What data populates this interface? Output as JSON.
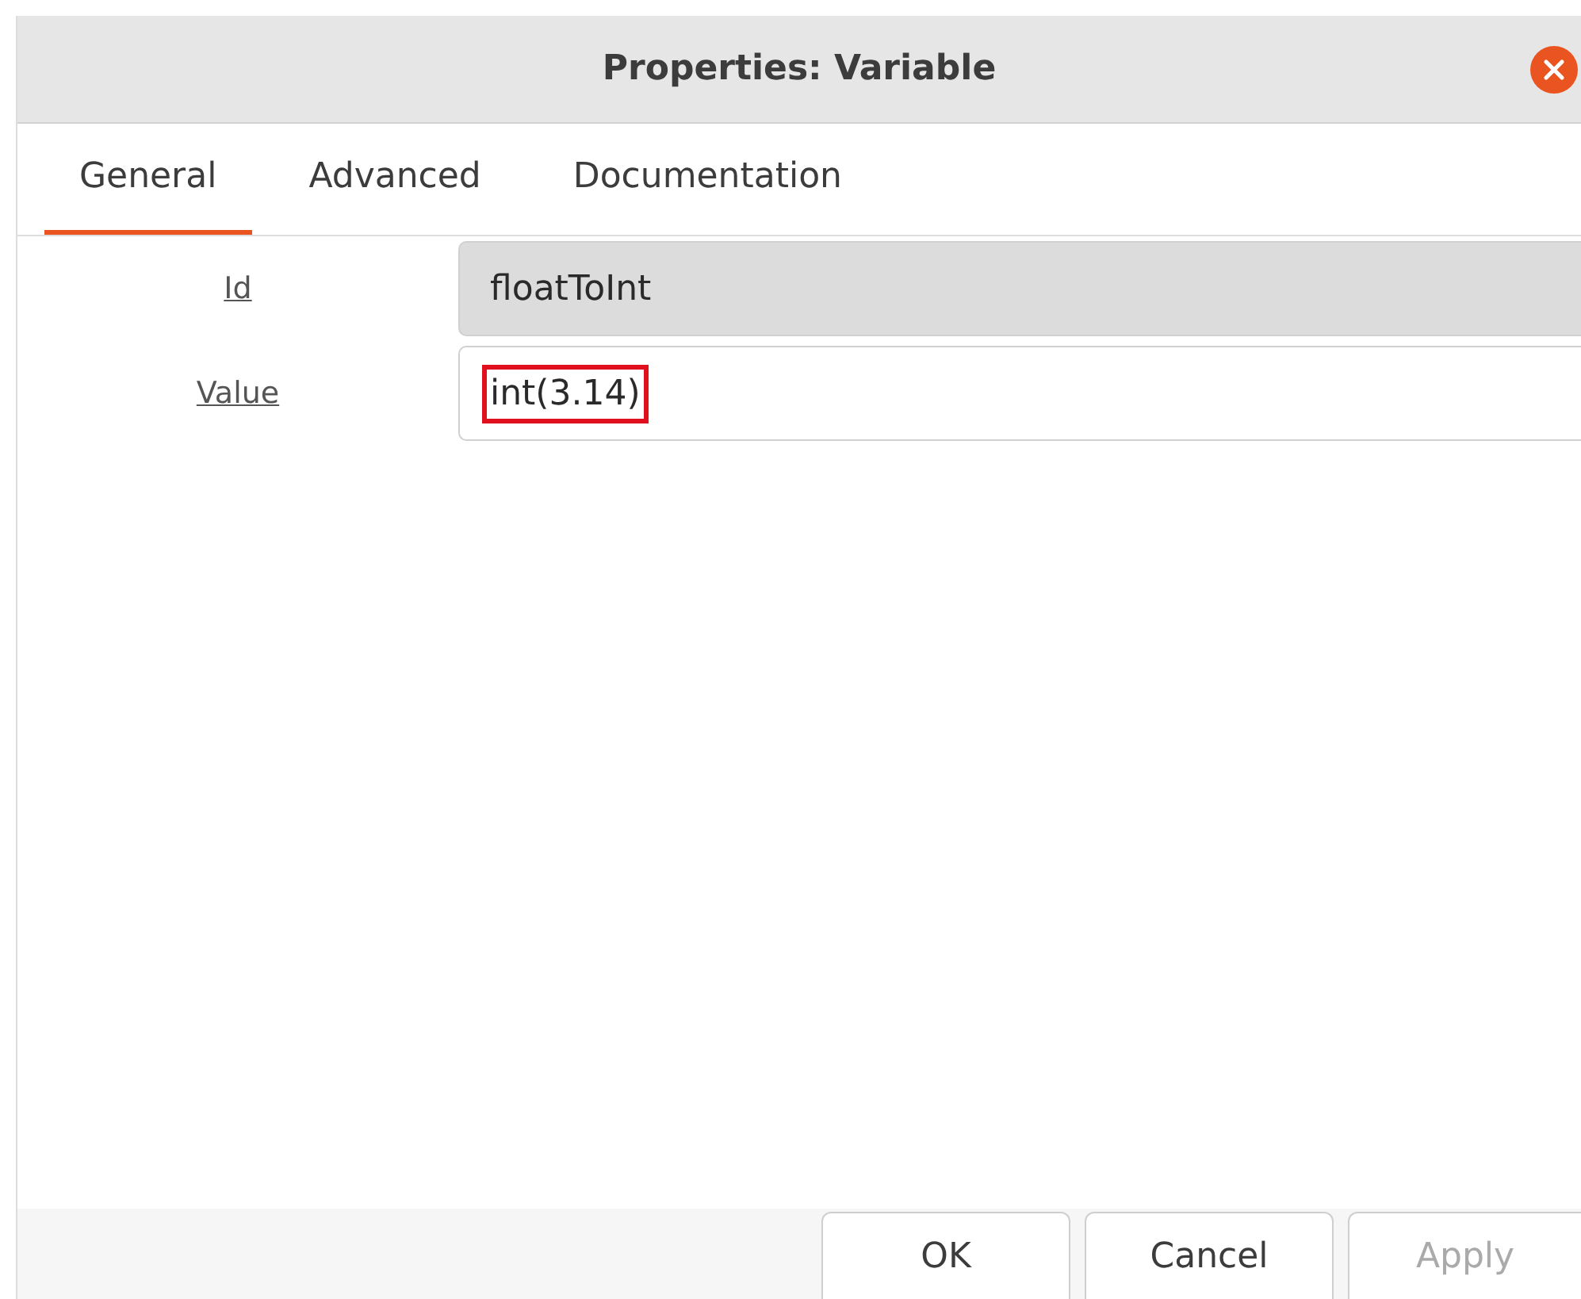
{
  "window": {
    "title": "Properties: Variable"
  },
  "tabs": [
    {
      "label": "General",
      "selected": true
    },
    {
      "label": "Advanced",
      "selected": false
    },
    {
      "label": "Documentation",
      "selected": false
    }
  ],
  "fields": [
    {
      "label": "Id",
      "value": "floatToInt",
      "disabled": true,
      "highlighted": false
    },
    {
      "label": "Value",
      "value": "int(3.14)",
      "disabled": false,
      "highlighted": true
    }
  ],
  "buttons": [
    {
      "label": "OK",
      "disabled": false
    },
    {
      "label": "Cancel",
      "disabled": false
    },
    {
      "label": "Apply",
      "disabled": true
    }
  ]
}
